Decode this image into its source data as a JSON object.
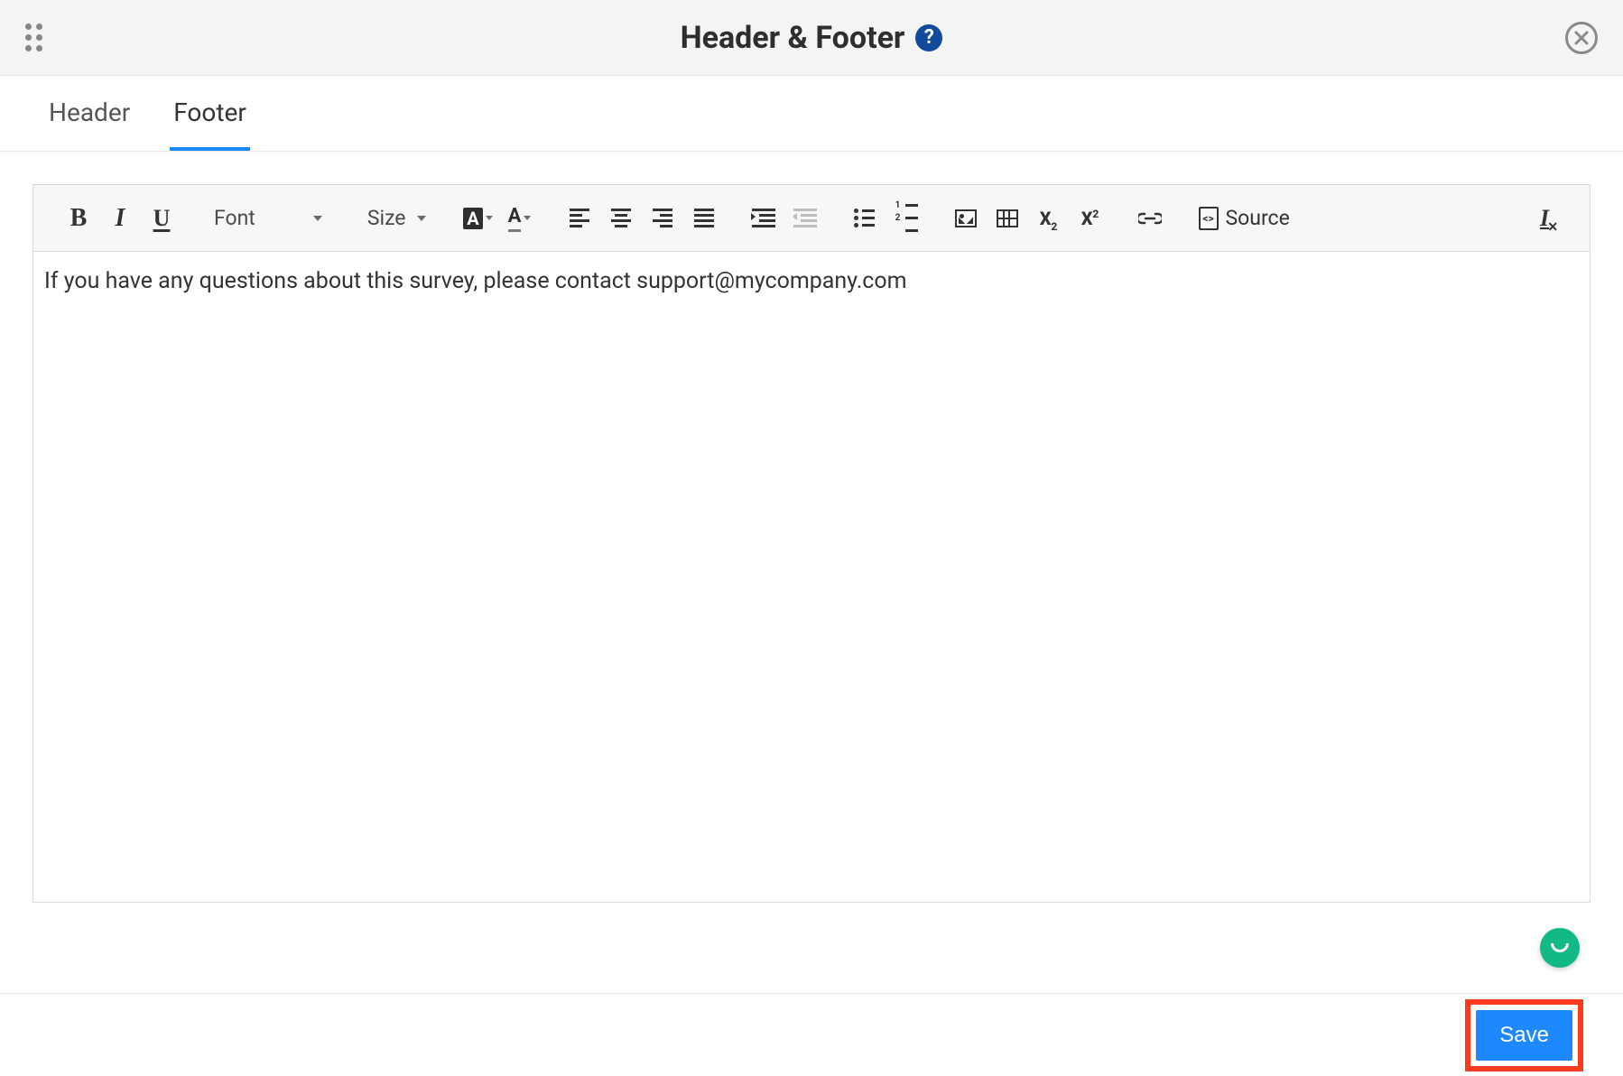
{
  "header": {
    "title": "Header & Footer"
  },
  "tabs": {
    "header": "Header",
    "footer": "Footer",
    "active": "footer"
  },
  "toolbar": {
    "font_label": "Font",
    "size_label": "Size",
    "source_label": "Source"
  },
  "editor": {
    "content": "If you have any questions about this survey, please contact support@mycompany.com"
  },
  "actions": {
    "save_label": "Save"
  }
}
